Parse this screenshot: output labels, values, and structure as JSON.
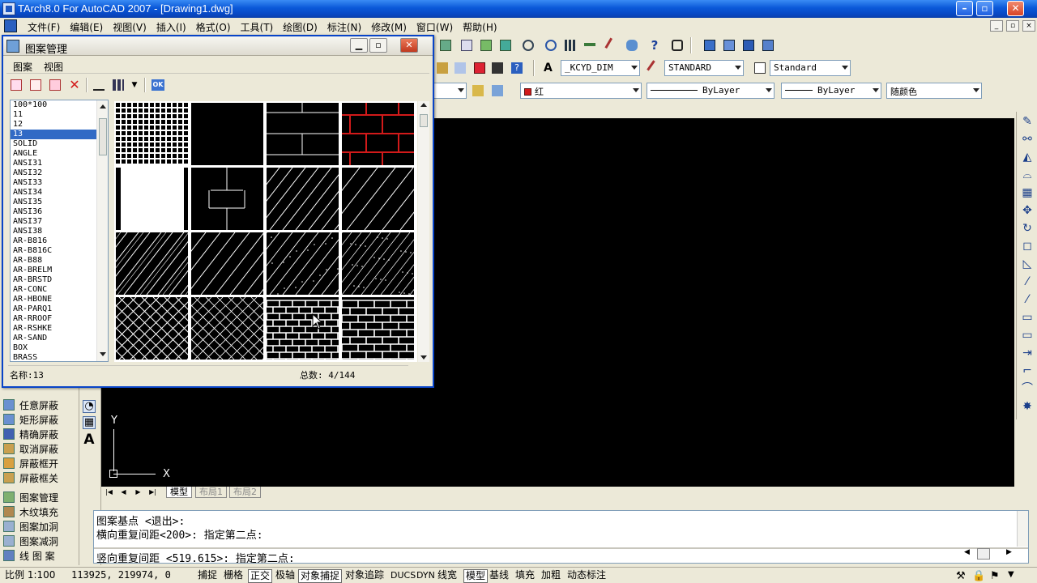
{
  "window": {
    "title": "TArch8.0 For AutoCAD 2007 - [Drawing1.dwg]"
  },
  "menu": [
    "文件(F)",
    "编辑(E)",
    "视图(V)",
    "插入(I)",
    "格式(O)",
    "工具(T)",
    "绘图(D)",
    "标注(N)",
    "修改(M)",
    "窗口(W)",
    "帮助(H)"
  ],
  "toolbar": {
    "dimstyle": "_KCYD_DIM",
    "tablestyle": "STANDARD",
    "textstyle": "Standard",
    "color": "红",
    "linetype": "ByLayer",
    "lineweight": "ByLayer",
    "plotstyle": "随颜色"
  },
  "dialog": {
    "title": "图案管理",
    "menu": [
      "图案",
      "视图"
    ],
    "ok_label": "OK",
    "hatch_list": [
      "100*100",
      "11",
      "12",
      "13",
      "SOLID",
      "ANGLE",
      "ANSI31",
      "ANSI32",
      "ANSI33",
      "ANSI34",
      "ANSI35",
      "ANSI36",
      "ANSI37",
      "ANSI38",
      "AR-B816",
      "AR-B816C",
      "AR-B88",
      "AR-BRELM",
      "AR-BRSTD",
      "AR-CONC",
      "AR-HBONE",
      "AR-PARQ1",
      "AR-RROOF",
      "AR-RSHKE",
      "AR-SAND",
      "BOX",
      "BRASS"
    ],
    "selected": "13",
    "name_label": "名称:13",
    "total_label": "总数: 4/144",
    "colors": {
      "selection": "#316ac5",
      "red_brick": "#d21a1a"
    }
  },
  "left_palette": {
    "items": [
      "任意屏蔽",
      "矩形屏蔽",
      "精确屏蔽",
      "取消屏蔽",
      "屏蔽框开",
      "屏蔽框关",
      "图案管理",
      "木纹填充",
      "图案加洞",
      "图案减洞",
      "线 图 案"
    ]
  },
  "layout_tabs": [
    "模型",
    "布局1",
    "布局2"
  ],
  "ucs": {
    "x": "X",
    "y": "Y"
  },
  "command": {
    "lines": [
      "图案基点 <退出>:",
      "横向重复间距<200>: 指定第二点:"
    ],
    "prompt": "竖向重复间距 <519.615>:  指定第二点:"
  },
  "status": {
    "scale": "比例 1:100",
    "coords": "113925, 219974, 0",
    "toggles": [
      "捕捉",
      "栅格",
      "正交",
      "极轴",
      "对象捕捉",
      "对象追踪",
      "DUCS",
      "DYN",
      "线宽",
      "模型",
      "基线",
      "填充",
      "加粗",
      "动态标注"
    ],
    "pressed": [
      "正交",
      "对象捕捉",
      "模型"
    ]
  }
}
